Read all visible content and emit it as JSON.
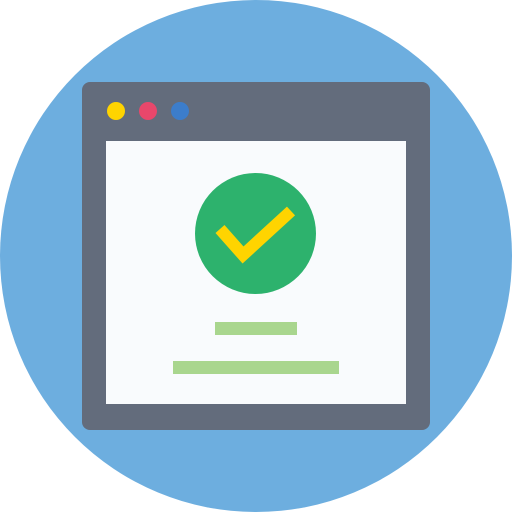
{
  "icon": "browser-window-success-icon",
  "colors": {
    "background_circle": "#6DAEDF",
    "window_frame": "#636C7C",
    "window_content": "#F9FBFD",
    "dot_yellow": "#FFD400",
    "dot_red": "#E8476B",
    "dot_blue": "#3C7DCB",
    "success_circle": "#2DB26D",
    "checkmark": "#FFD400",
    "text_line": "#A9D68E"
  },
  "window": {
    "controls": [
      "yellow-dot",
      "red-dot",
      "blue-dot"
    ]
  },
  "status": {
    "icon": "checkmark-icon",
    "text_lines": 2
  }
}
